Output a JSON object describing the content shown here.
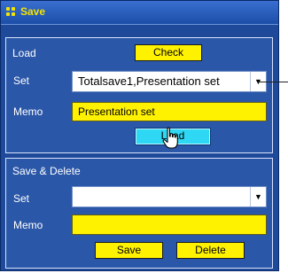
{
  "window": {
    "title": "Save",
    "title_color": "#f4e400",
    "frame_color": "#1f4a9a"
  },
  "load": {
    "section_label": "Load",
    "check_label": "Check",
    "set_label": "Set",
    "set_value": "Totalsave1,Presentation set",
    "memo_label": "Memo",
    "memo_value": "Presentation set",
    "load_label": "Load"
  },
  "save_delete": {
    "section_label": "Save & Delete",
    "set_label": "Set",
    "set_value": "",
    "memo_label": "Memo",
    "memo_value": "",
    "save_label": "Save",
    "delete_label": "Delete"
  },
  "icons": {
    "title": "grid-icon",
    "dropdown": "triangle-down-icon",
    "cursor": "hand-pointer-icon"
  },
  "colors": {
    "button_yellow": "#fff200",
    "button_active": "#2ed8f4",
    "panel": "#2b57a8"
  }
}
